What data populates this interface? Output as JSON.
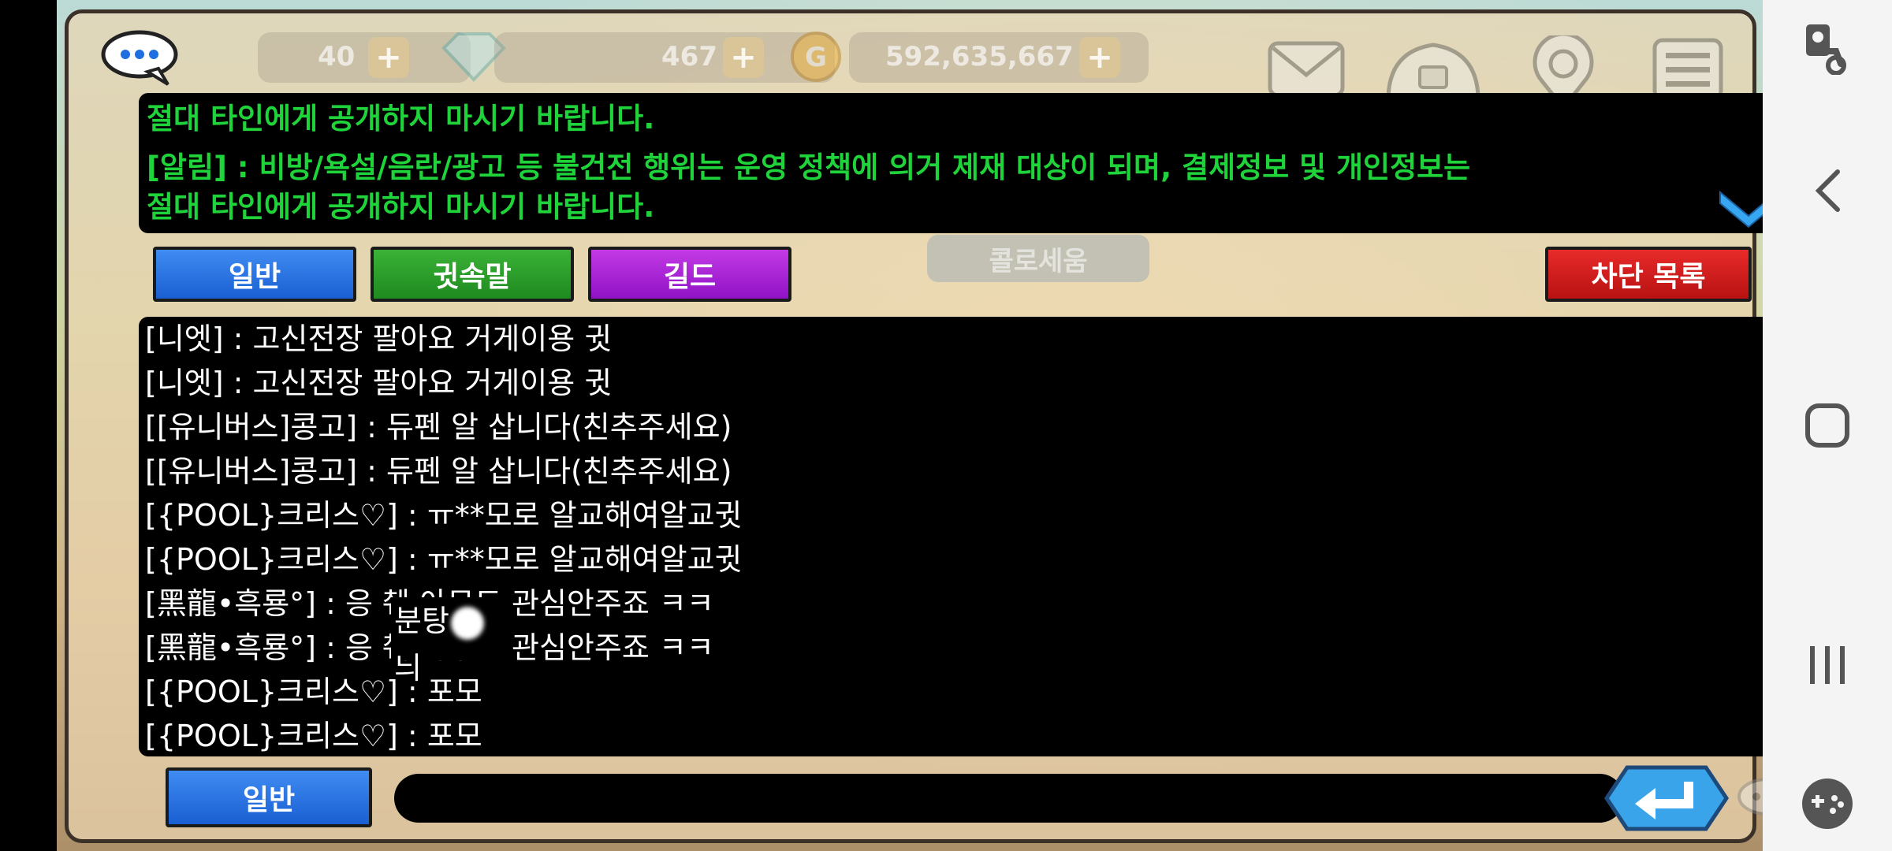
{
  "topbar": {
    "currency1_value": "40",
    "gems_value": "467",
    "gold_value": "592,635,667",
    "plus_label": "+"
  },
  "notice": {
    "lines": [
      "절대 타인에게 공개하지 마시기 바랍니다.",
      "[알림] : 비방/욕설/음란/광고 등 불건전 행위는 운영 정책에 의거 제재 대상이 되며, 결제정보 및 개인정보는",
      "절대 타인에게 공개하지 마시기 바랍니다."
    ]
  },
  "tabs": {
    "normal": "일반",
    "whisper": "귓속말",
    "guild": "길드",
    "block_list": "차단 목록"
  },
  "background_label": "콜로세움",
  "messages": [
    "[니엣] : 고신전장 팔아요 거게이용 귓",
    "[니엣] : 고신전장 팔아요 거게이용 귓",
    "[[유니버스]콩고] : 듀펜 알 삽니다(친추주세요)",
    "[[유니버스]콩고] : 듀펜 알 삽니다(친추주세요)",
    "[{POOL}크리스♡] : ㅠ**모로 알교해여알교귓",
    "[{POOL}크리스♡] : ㅠ**모로 알교해여알교귓",
    "[黑龍•흑룡°] : 응                 췌 아무도 관심안주죠 ㅋㅋ",
    "[黑龍•흑룡°] : 응                 췌 아무도 관심안주죠 ㅋㅋ",
    "[{POOL}크리스♡] : 포모",
    "[{POOL}크리스♡] : 포모"
  ],
  "overlay": {
    "left": "분탕",
    "right": "늬"
  },
  "input": {
    "channel_label": "일반",
    "value": ""
  },
  "colors": {
    "notice_text": "#1fd33a",
    "tab_normal": "#2a74e0",
    "tab_whisper": "#2aa02a",
    "tab_guild": "#a824d8",
    "tab_block": "#d01c1c"
  },
  "icons": {
    "chat": "chat-bubble-icon",
    "gem": "gem-icon",
    "gold": "gold-coin-icon",
    "mail": "mail-icon",
    "shop": "shop-icon",
    "location": "location-icon",
    "menu": "menu-icon",
    "expand": "chevron-down-icon",
    "send": "enter-icon",
    "nav_accessibility": "accessibility-icon",
    "nav_back": "back-icon",
    "nav_home": "home-icon",
    "nav_recents": "recents-icon",
    "nav_game": "game-tools-icon"
  }
}
